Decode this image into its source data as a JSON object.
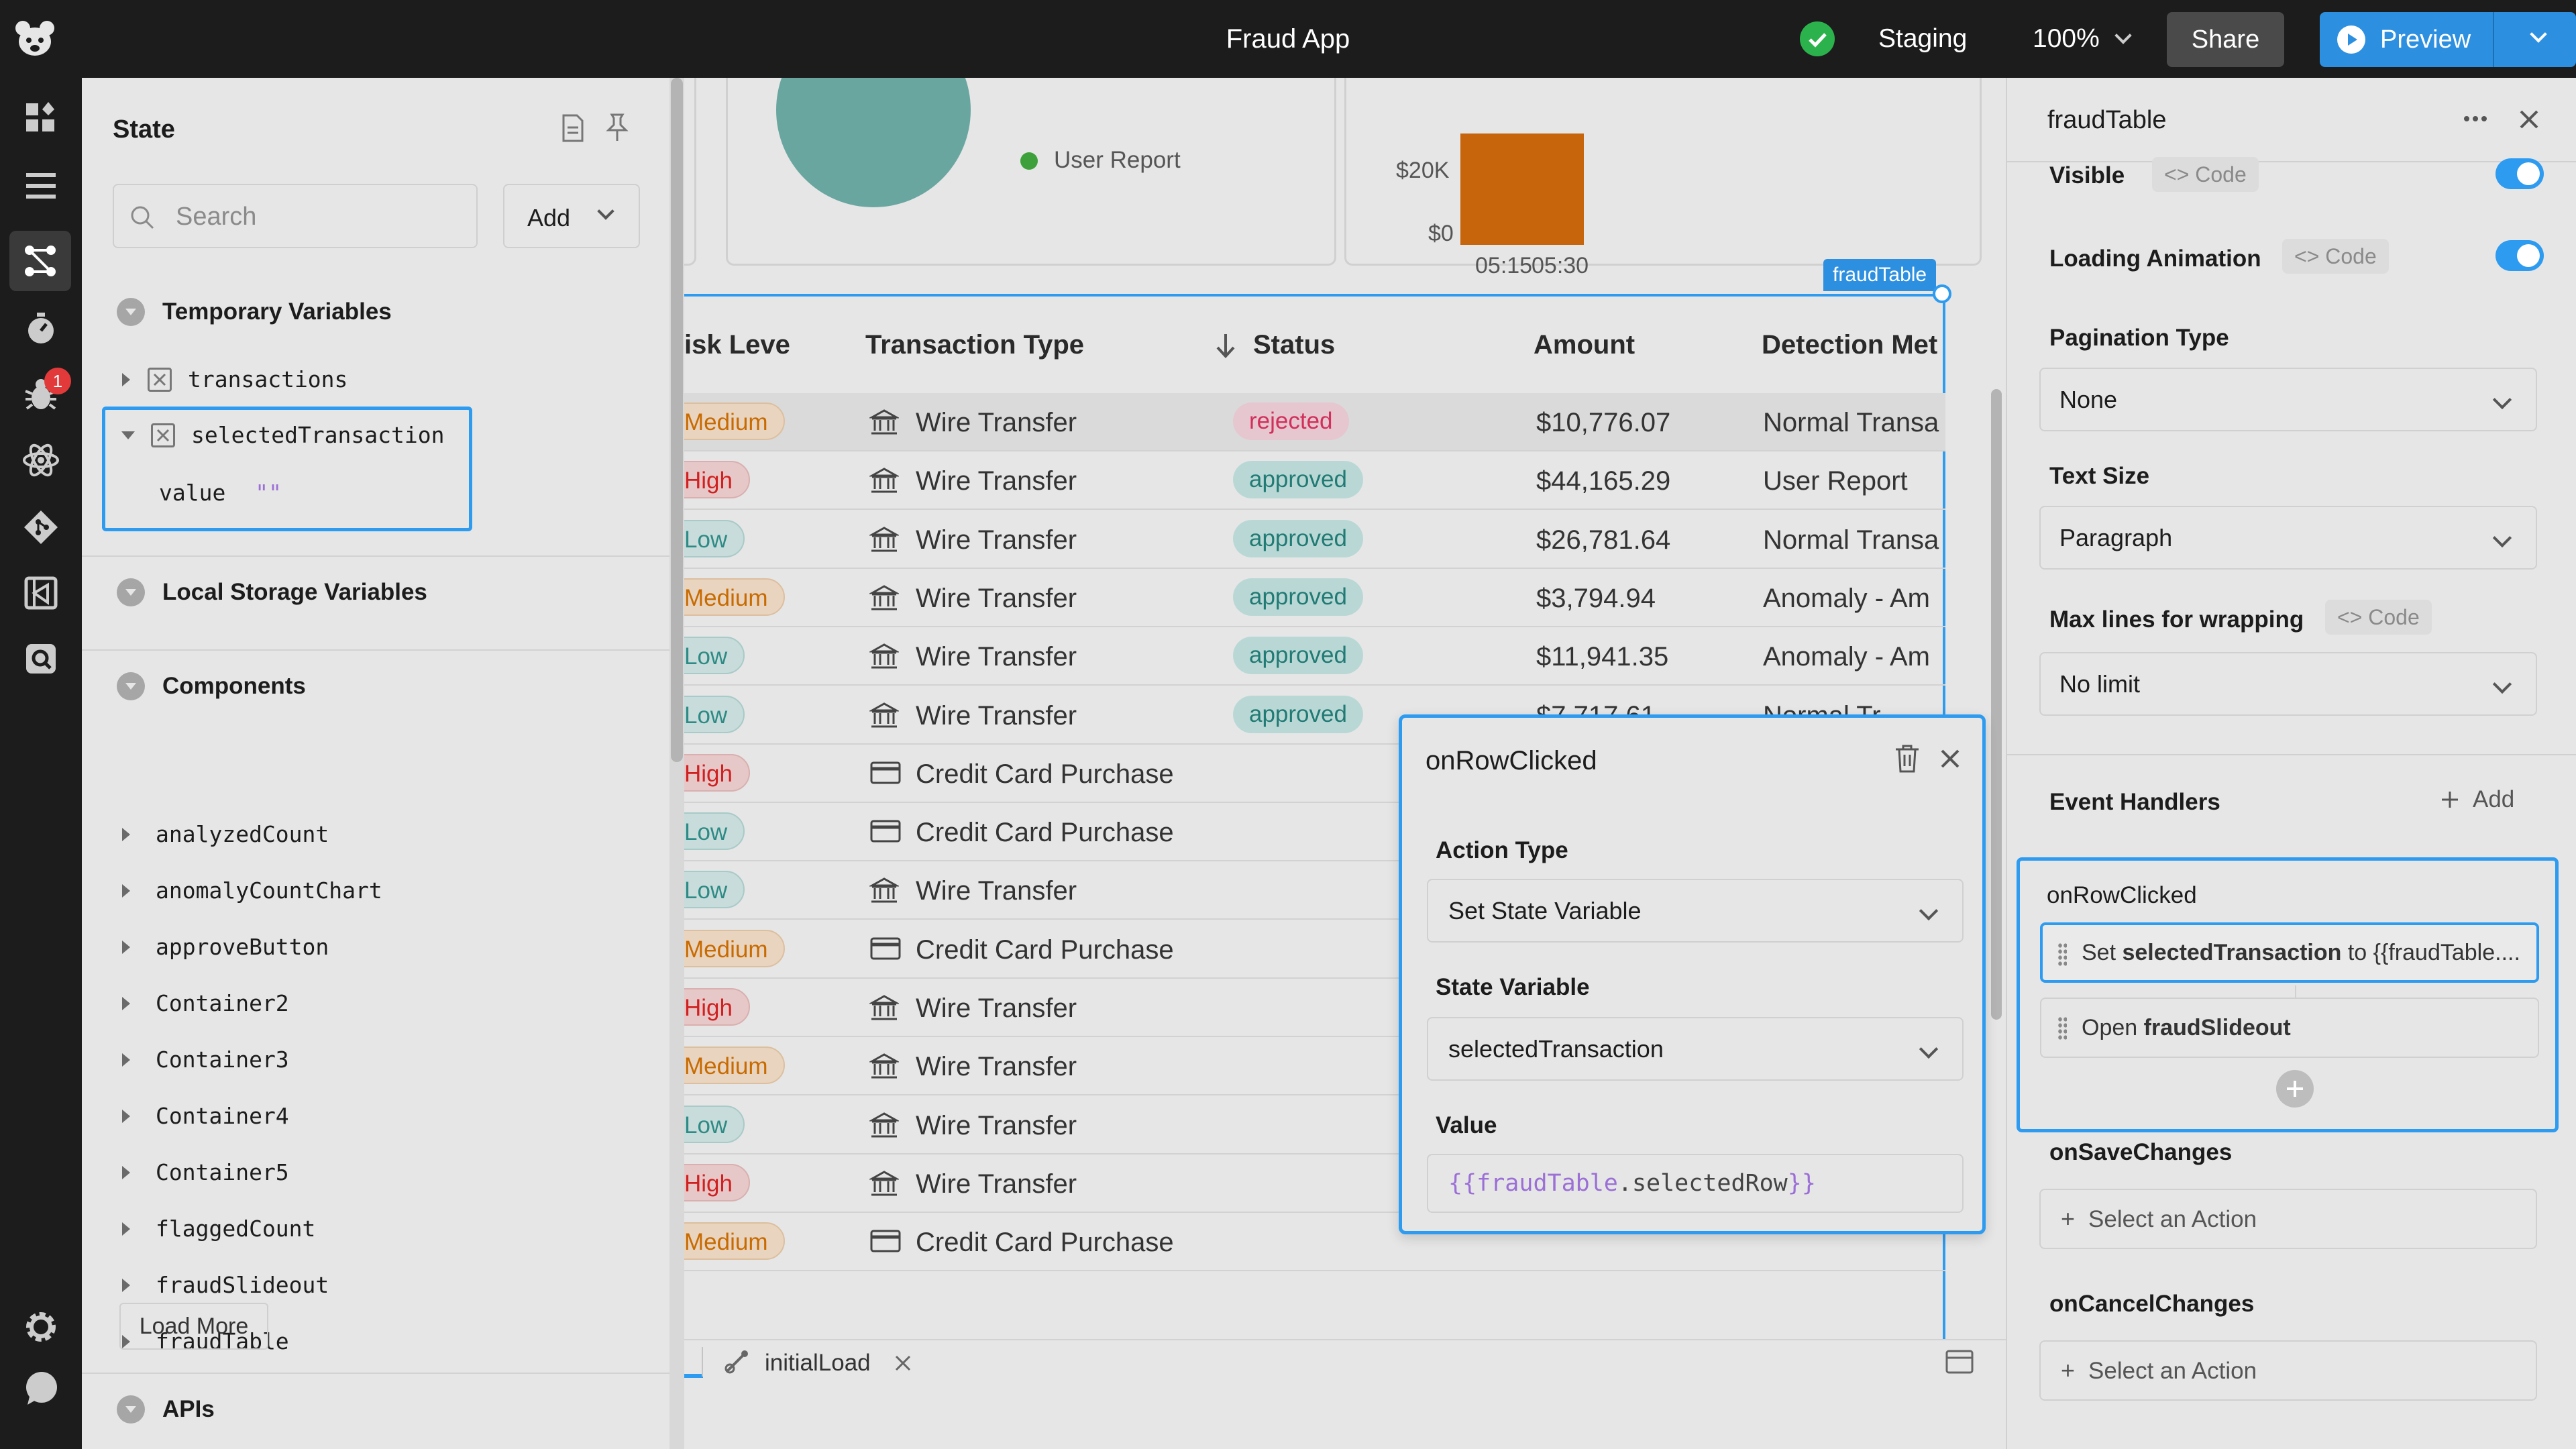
{
  "topbar": {
    "app_title": "Fraud App",
    "environment": "Staging",
    "zoom": "100%",
    "share_label": "Share",
    "preview_label": "Preview"
  },
  "rail": {
    "icons": [
      "components-icon",
      "list-icon",
      "state-graph-icon",
      "timer-icon",
      "bug-icon",
      "atom-icon",
      "git-icon",
      "code-library-icon",
      "search-box-icon",
      "settings-icon",
      "chat-icon"
    ],
    "bug_badge": "1"
  },
  "state_panel": {
    "title": "State",
    "search_placeholder": "Search",
    "add_label": "Add",
    "temp_vars_title": "Temporary Variables",
    "temp_vars": [
      {
        "name": "transactions"
      },
      {
        "name": "selectedTransaction",
        "value_label": "value",
        "value": "\"\""
      }
    ],
    "local_storage_title": "Local Storage Variables",
    "components_title": "Components",
    "components": [
      "analyzedCount",
      "anomalyCountChart",
      "approveButton",
      "Container2",
      "Container3",
      "Container4",
      "Container5",
      "flaggedCount",
      "fraudSlideout",
      "fraudTable"
    ],
    "load_more": "Load More",
    "apis_title": "APIs"
  },
  "canvas": {
    "legend_item": "User Report",
    "bar_chart": {
      "y_ticks": [
        "$20K",
        "$0"
      ],
      "x_ticks": [
        "05:15",
        "05:30"
      ]
    },
    "component_tag": "fraudTable",
    "table": {
      "columns": [
        "isk Leve",
        "Transaction Type",
        "Status",
        "Amount",
        "Detection Met"
      ],
      "rows": [
        {
          "risk": "Medium",
          "type": "Wire Transfer",
          "status": "rejected",
          "amount": "$10,776.07",
          "method": "Normal Transa"
        },
        {
          "risk": "High",
          "type": "Wire Transfer",
          "status": "approved",
          "amount": "$44,165.29",
          "method": "User Report"
        },
        {
          "risk": "Low",
          "type": "Wire Transfer",
          "status": "approved",
          "amount": "$26,781.64",
          "method": "Normal Transa"
        },
        {
          "risk": "Medium",
          "type": "Wire Transfer",
          "status": "approved",
          "amount": "$3,794.94",
          "method": "Anomaly - Am"
        },
        {
          "risk": "Low",
          "type": "Wire Transfer",
          "status": "approved",
          "amount": "$11,941.35",
          "method": "Anomaly - Am"
        },
        {
          "risk": "Low",
          "type": "Wire Transfer",
          "status": "approved",
          "amount": "$7,717.61",
          "method": "Normal Tr"
        },
        {
          "risk": "High",
          "type": "Credit Card Purchase",
          "status": "",
          "amount": "",
          "method": ""
        },
        {
          "risk": "Low",
          "type": "Credit Card Purchase",
          "status": "",
          "amount": "",
          "method": ""
        },
        {
          "risk": "Low",
          "type": "Wire Transfer",
          "status": "",
          "amount": "",
          "method": ""
        },
        {
          "risk": "Medium",
          "type": "Credit Card Purchase",
          "status": "",
          "amount": "",
          "method": ""
        },
        {
          "risk": "High",
          "type": "Wire Transfer",
          "status": "",
          "amount": "",
          "method": ""
        },
        {
          "risk": "Medium",
          "type": "Wire Transfer",
          "status": "",
          "amount": "",
          "method": ""
        },
        {
          "risk": "Low",
          "type": "Wire Transfer",
          "status": "",
          "amount": "",
          "method": ""
        },
        {
          "risk": "High",
          "type": "Wire Transfer",
          "status": "",
          "amount": "",
          "method": ""
        },
        {
          "risk": "Medium",
          "type": "Credit Card Purchase",
          "status": "",
          "amount": "",
          "method": ""
        }
      ]
    },
    "bottom_tab": "initialLoad"
  },
  "popover": {
    "title": "onRowClicked",
    "action_type_label": "Action Type",
    "action_type_value": "Set State Variable",
    "state_variable_label": "State Variable",
    "state_variable_value": "selectedTransaction",
    "value_label": "Value",
    "value_open": "{{",
    "value_obj": "fraudTable",
    "value_prop": ".selectedRow",
    "value_close": "}}"
  },
  "inspector": {
    "title": "fraudTable",
    "visible_label": "Visible",
    "code_label": "Code",
    "loading_label": "Loading Animation",
    "pagination_label": "Pagination Type",
    "pagination_value": "None",
    "text_size_label": "Text Size",
    "text_size_value": "Paragraph",
    "max_lines_label": "Max lines for wrapping",
    "max_lines_value": "No limit",
    "event_handlers_label": "Event Handlers",
    "add_label": "Add",
    "handler1": {
      "name": "onRowClicked",
      "action1_prefix": "Set ",
      "action1_var": "selectedTransaction",
      "action1_suffix": " to {{fraudTable....",
      "action2_prefix": "Open ",
      "action2_target": "fraudSlideout"
    },
    "handler2_name": "onSaveChanges",
    "handler3_name": "onCancelChanges",
    "select_action": "Select an Action"
  }
}
